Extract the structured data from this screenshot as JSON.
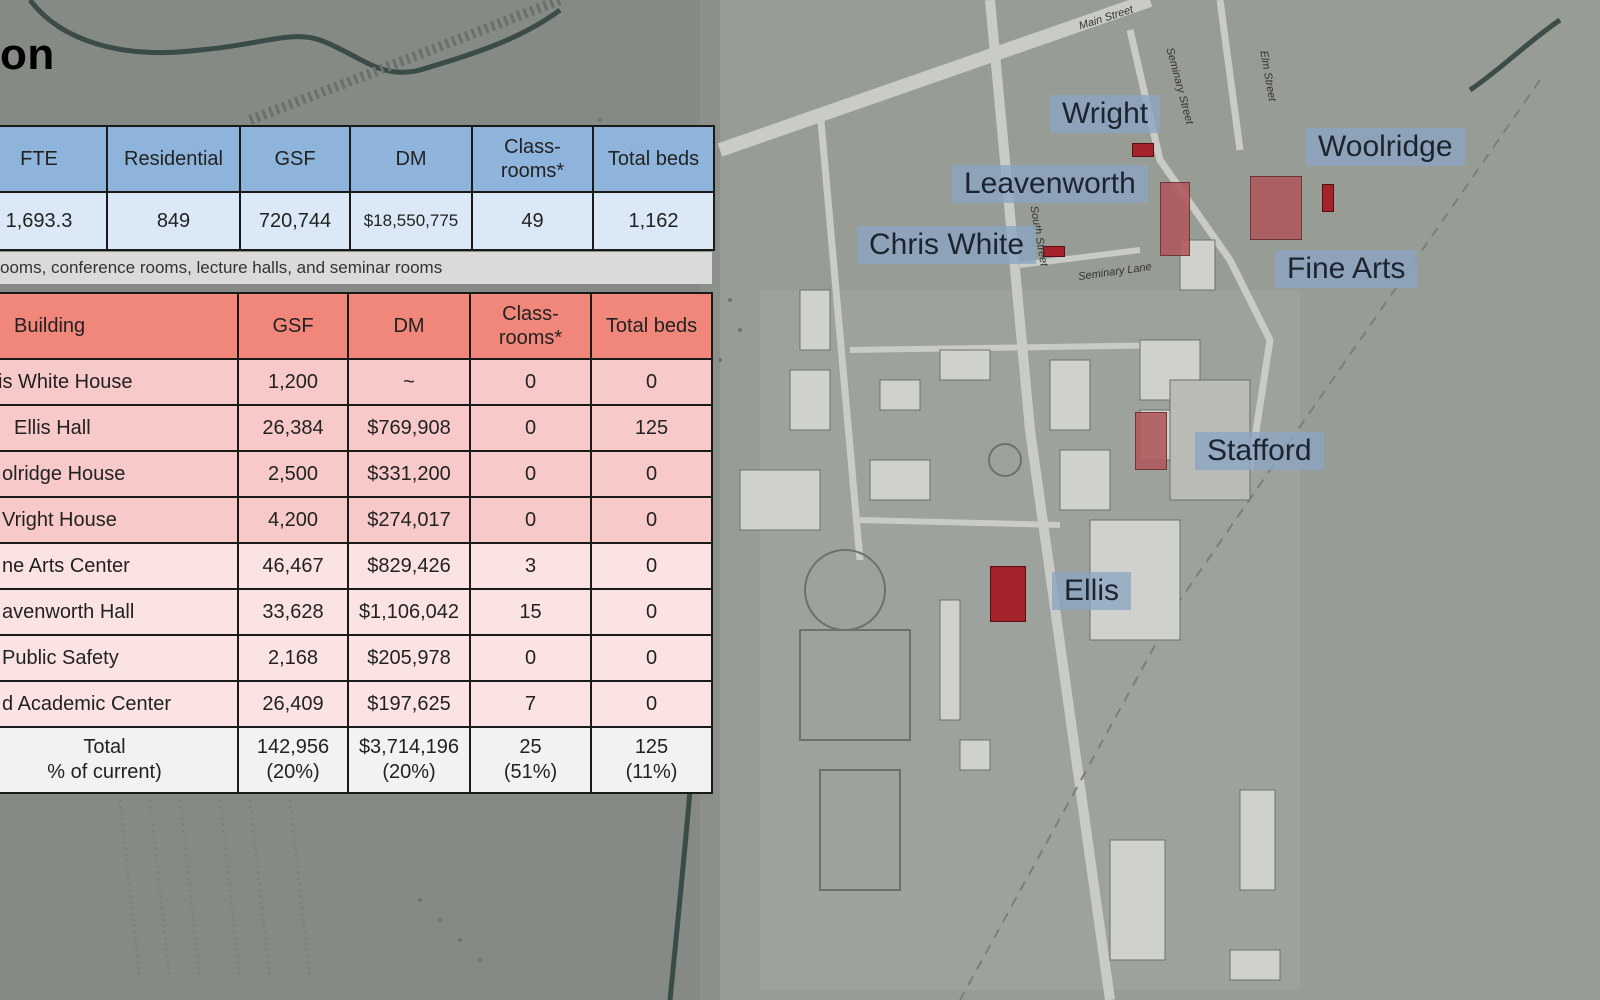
{
  "page": {
    "title": "on"
  },
  "summary_table": {
    "headers": [
      "FTE",
      "Residential",
      "GSF",
      "DM",
      "Class-\nrooms*",
      "Total beds"
    ],
    "values": [
      "1,693.3",
      "849",
      "720,744",
      "$18,550,775",
      "49",
      "1,162"
    ]
  },
  "footnote": "ooms, conference rooms, lecture halls, and seminar rooms",
  "building_table": {
    "headers": [
      "Building",
      "GSF",
      "DM",
      "Class-\nrooms*",
      "Total beds"
    ],
    "rows": [
      [
        "is White House",
        "1,200",
        "~",
        "0",
        "0"
      ],
      [
        "Ellis Hall",
        "26,384",
        "$769,908",
        "0",
        "125"
      ],
      [
        "olridge House",
        "2,500",
        "$331,200",
        "0",
        "0"
      ],
      [
        "Vright House",
        "4,200",
        "$274,017",
        "0",
        "0"
      ],
      [
        "ne Arts Center",
        "46,467",
        "$829,426",
        "3",
        "0"
      ],
      [
        "avenworth Hall",
        "33,628",
        "$1,106,042",
        "15",
        "0"
      ],
      [
        "Public Safety",
        "2,168",
        "$205,978",
        "0",
        "0"
      ],
      [
        "d Academic Center",
        "26,409",
        "$197,625",
        "7",
        "0"
      ]
    ],
    "total": [
      "Total\n% of current)",
      "142,956\n(20%)",
      "$3,714,196\n(20%)",
      "25\n(51%)",
      "125\n(11%)"
    ]
  },
  "map_labels": {
    "wright": "Wright",
    "woolridge": "Woolridge",
    "leavenworth": "Leavenworth",
    "chris_white": "Chris White",
    "fine_arts": "Fine Arts",
    "stafford": "Stafford",
    "ellis": "Ellis"
  },
  "streets": {
    "main": "Main Street",
    "seminary": "Seminary Street",
    "elm": "Elm Street",
    "south": "South Street",
    "seminary_lane": "Seminary Lane"
  },
  "colors": {
    "summary_header": "#8fb4dc",
    "summary_row": "#dbe9f6",
    "building_header": "#f0877a",
    "highlight_building": "#a5232a",
    "label_box": "#8ca5c3"
  }
}
